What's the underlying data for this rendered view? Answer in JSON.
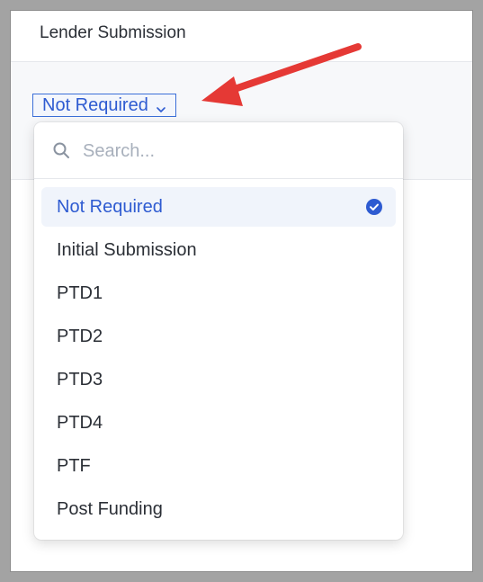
{
  "header": {
    "title": "Lender Submission"
  },
  "dropdown": {
    "selected_label": "Not Required",
    "search_placeholder": "Search...",
    "options": [
      {
        "label": "Not Required",
        "selected": true
      },
      {
        "label": "Initial Submission",
        "selected": false
      },
      {
        "label": "PTD1",
        "selected": false
      },
      {
        "label": "PTD2",
        "selected": false
      },
      {
        "label": "PTD3",
        "selected": false
      },
      {
        "label": "PTD4",
        "selected": false
      },
      {
        "label": "PTF",
        "selected": false
      },
      {
        "label": "Post Funding",
        "selected": false
      }
    ]
  },
  "colors": {
    "accent": "#2e5bd1",
    "annotation_arrow": "#e53935",
    "selected_bg": "#f0f4fb"
  }
}
